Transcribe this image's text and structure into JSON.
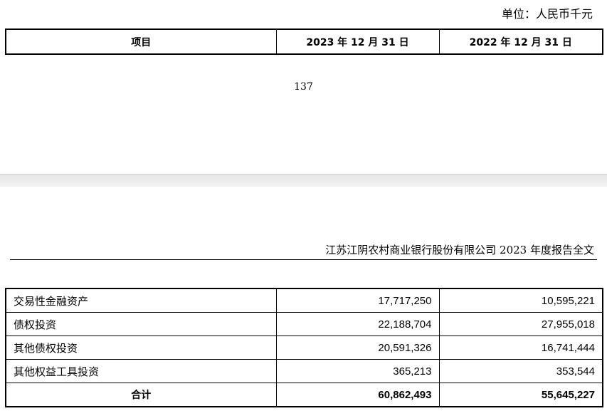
{
  "unit_label": "单位：人民币千元",
  "header": {
    "col_item": "项目",
    "col_2023": "2023 年 12 月 31 日",
    "col_2022": "2022 年 12 月 31 日"
  },
  "page_number": "137",
  "report_title": "江苏江阴农村商业银行股份有限公司 2023 年度报告全文",
  "rows": [
    {
      "label": "交易性金融资产",
      "v2023": "17,717,250",
      "v2022": "10,595,221"
    },
    {
      "label": "债权投资",
      "v2023": "22,188,704",
      "v2022": "27,955,018"
    },
    {
      "label": "其他债权投资",
      "v2023": "20,591,326",
      "v2022": "16,741,444"
    },
    {
      "label": "其他权益工具投资",
      "v2023": "365,213",
      "v2022": "353,544"
    }
  ],
  "total": {
    "label": "合计",
    "v2023": "60,862,493",
    "v2022": "55,645,227"
  }
}
